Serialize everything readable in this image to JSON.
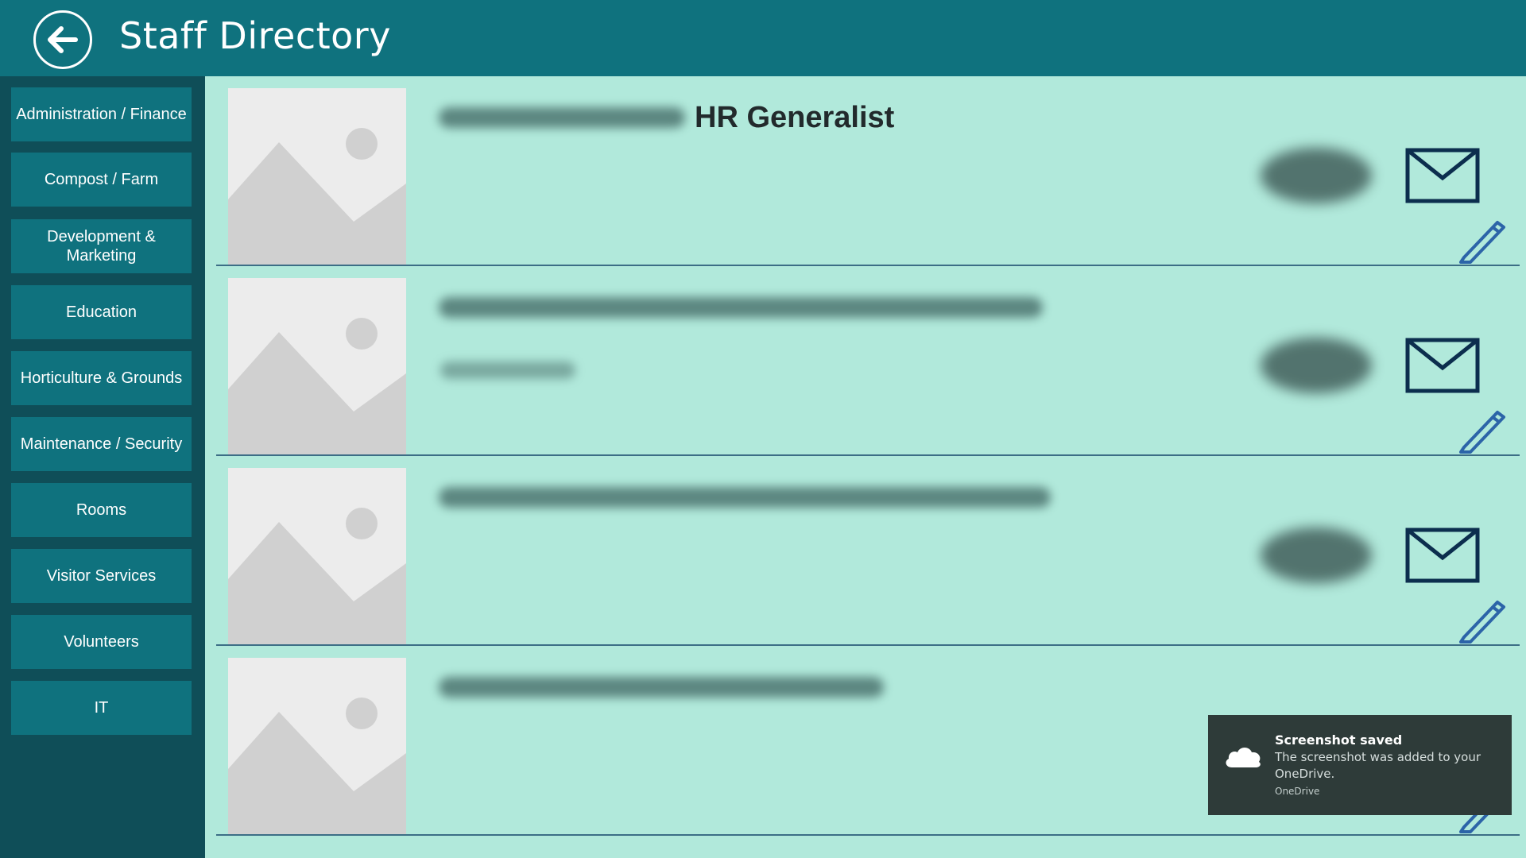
{
  "header": {
    "back_icon": "arrow-left-icon",
    "title": "Staff Directory"
  },
  "sidebar": {
    "items": [
      {
        "label": "Administration / Finance"
      },
      {
        "label": "Compost / Farm"
      },
      {
        "label": "Development & Marketing"
      },
      {
        "label": "Education"
      },
      {
        "label": "Horticulture & Grounds"
      },
      {
        "label": "Maintenance / Security"
      },
      {
        "label": "Rooms"
      },
      {
        "label": "Visitor Services"
      },
      {
        "label": "Volunteers"
      },
      {
        "label": "IT"
      }
    ]
  },
  "staff": [
    {
      "title": "HR Generalist",
      "has_email": true
    },
    {
      "title": "",
      "has_email": true
    },
    {
      "title": "",
      "has_email": true
    },
    {
      "title": "",
      "has_email": true
    }
  ],
  "toast": {
    "title": "Screenshot saved",
    "body": "The screenshot was added to your OneDrive.",
    "source": "OneDrive",
    "icon": "cloud-icon"
  },
  "colors": {
    "header_bg": "#0f727e",
    "sidebar_bg": "#0f4e58",
    "button_bg": "#0f727e",
    "content_bg": "#b1e9db",
    "icon_navy": "#0c2e4e",
    "pencil_blue": "#2c64a8",
    "toast_bg": "#2e3b39"
  }
}
